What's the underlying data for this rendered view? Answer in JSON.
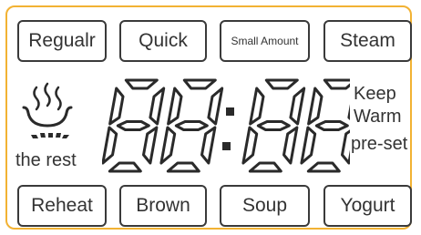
{
  "top_buttons": [
    {
      "label": "Regualr"
    },
    {
      "label": "Quick"
    },
    {
      "label": "Small Amount"
    },
    {
      "label": "Steam"
    }
  ],
  "bottom_buttons": [
    {
      "label": "Reheat"
    },
    {
      "label": "Brown"
    },
    {
      "label": "Soup"
    },
    {
      "label": "Yogurt"
    }
  ],
  "status": {
    "rest_label": "the rest",
    "keep_warm": "Keep Warm",
    "keep_label": "Keep",
    "warm_label": "Warm",
    "preset_label": "pre-set"
  },
  "display": {
    "value": "88:88"
  },
  "colors": {
    "border": "#f2b233",
    "segment": "#2a2a2a"
  }
}
